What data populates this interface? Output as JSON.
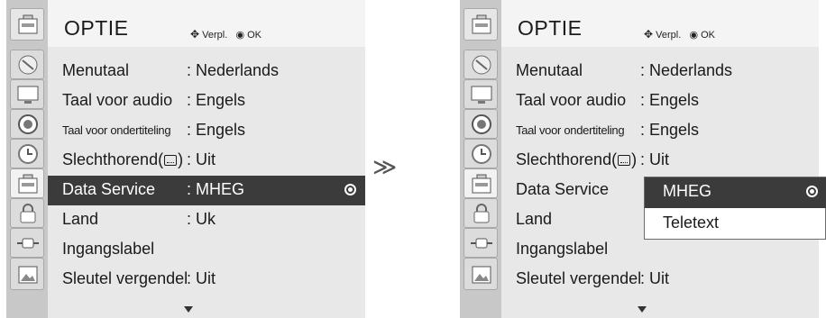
{
  "left_panel": {
    "title": "OPTIE",
    "hint_move": "Verpl.",
    "hint_ok": "OK",
    "rows": [
      {
        "label": "Menutaal",
        "value": ": Nederlands"
      },
      {
        "label": "Taal voor audio",
        "value": ": Engels"
      },
      {
        "label": "Taal voor ondertiteling",
        "value": ": Engels"
      },
      {
        "label": "Slechthorend(",
        "label_suffix": ")",
        "value": ": Uit"
      },
      {
        "label": "Data Service",
        "value": ": MHEG"
      },
      {
        "label": "Land",
        "value": ": Uk"
      },
      {
        "label": "Ingangslabel",
        "value": ""
      },
      {
        "label": "Sleutel vergendel",
        "value": ": Uit"
      }
    ]
  },
  "right_panel": {
    "title": "OPTIE",
    "hint_move": "Verpl.",
    "hint_ok": "OK",
    "rows": [
      {
        "label": "Menutaal",
        "value": ": Nederlands"
      },
      {
        "label": "Taal voor audio",
        "value": ": Engels"
      },
      {
        "label": "Taal voor ondertiteling",
        "value": ": Engels"
      },
      {
        "label": "Slechthorend(",
        "label_suffix": ")",
        "value": ": Uit"
      },
      {
        "label": "Data Service",
        "value": ""
      },
      {
        "label": "Land",
        "value": ""
      },
      {
        "label": "Ingangslabel",
        "value": ""
      },
      {
        "label": "Sleutel vergendel",
        "value": ": Uit"
      }
    ],
    "popup_options": [
      "MHEG",
      "Teletext"
    ],
    "popup_selected": "MHEG"
  },
  "transition_symbol": "≫",
  "sidebar_icons": [
    "option-icon",
    "satellite-dish-icon",
    "monitor-icon",
    "speaker-icon",
    "clock-icon",
    "option-icon",
    "lock-icon",
    "input-plug-icon",
    "picture-frame-icon"
  ],
  "colors": {
    "selected_row": "#3b3b3b",
    "menu_bg": "#e8e8e8",
    "sidebar_bg": "#c8c8c8"
  }
}
